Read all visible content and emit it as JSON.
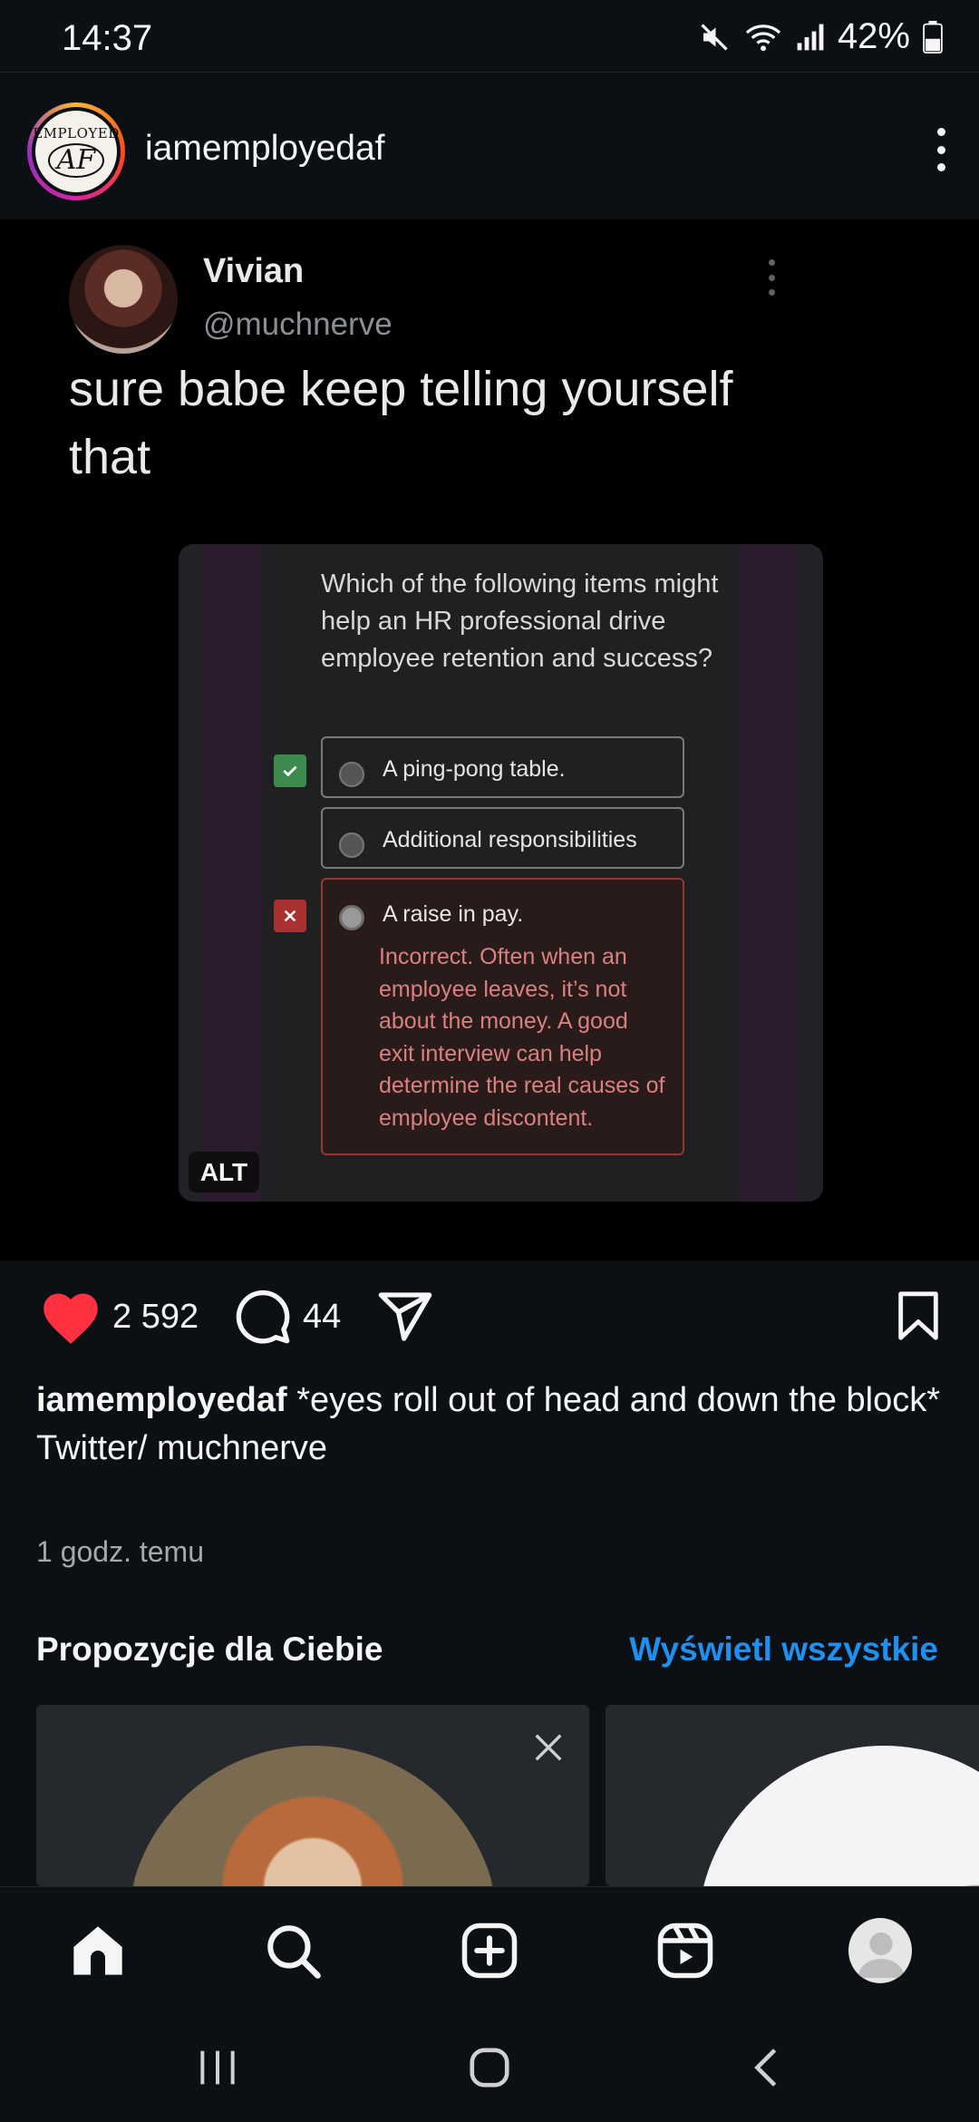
{
  "status_bar": {
    "time": "14:37",
    "battery": "42%"
  },
  "post": {
    "username": "iamemployedaf",
    "avatar_logo_top": "EMPLOYED",
    "avatar_logo_bottom": "AF",
    "tweet": {
      "name": "Vivian",
      "handle": "@muchnerve",
      "text": "sure babe keep telling yourself that"
    },
    "quiz": {
      "question": "Which of the following items might help an HR professional drive employee retention and success?",
      "options": [
        {
          "label": "A ping-pong table."
        },
        {
          "label": "Additional responsibilities"
        },
        {
          "label": "A raise in pay.",
          "feedback": "Incorrect. Often when an employee leaves, it’s not about the money. A good exit interview can help determine the real causes of employee discontent."
        }
      ]
    },
    "alt_badge": "ALT",
    "likes": "2 592",
    "comments": "44",
    "caption_text": "*eyes roll out of head and down the block*",
    "caption_line2": "Twitter/ muchnerve",
    "time_ago": "1 godz. temu"
  },
  "suggestions": {
    "title": "Propozycje dla Ciebie",
    "see_all": "Wyświetl wszystkie"
  },
  "colors": {
    "accent": "#1e90f0",
    "like": "#ff3040",
    "background": "#0c1014"
  },
  "icons": {
    "bottom_nav": [
      "home-icon",
      "search-icon",
      "create-icon",
      "reels-icon",
      "profile-avatar"
    ],
    "actions": [
      "heart-icon",
      "comment-icon",
      "share-icon",
      "bookmark-icon"
    ]
  }
}
